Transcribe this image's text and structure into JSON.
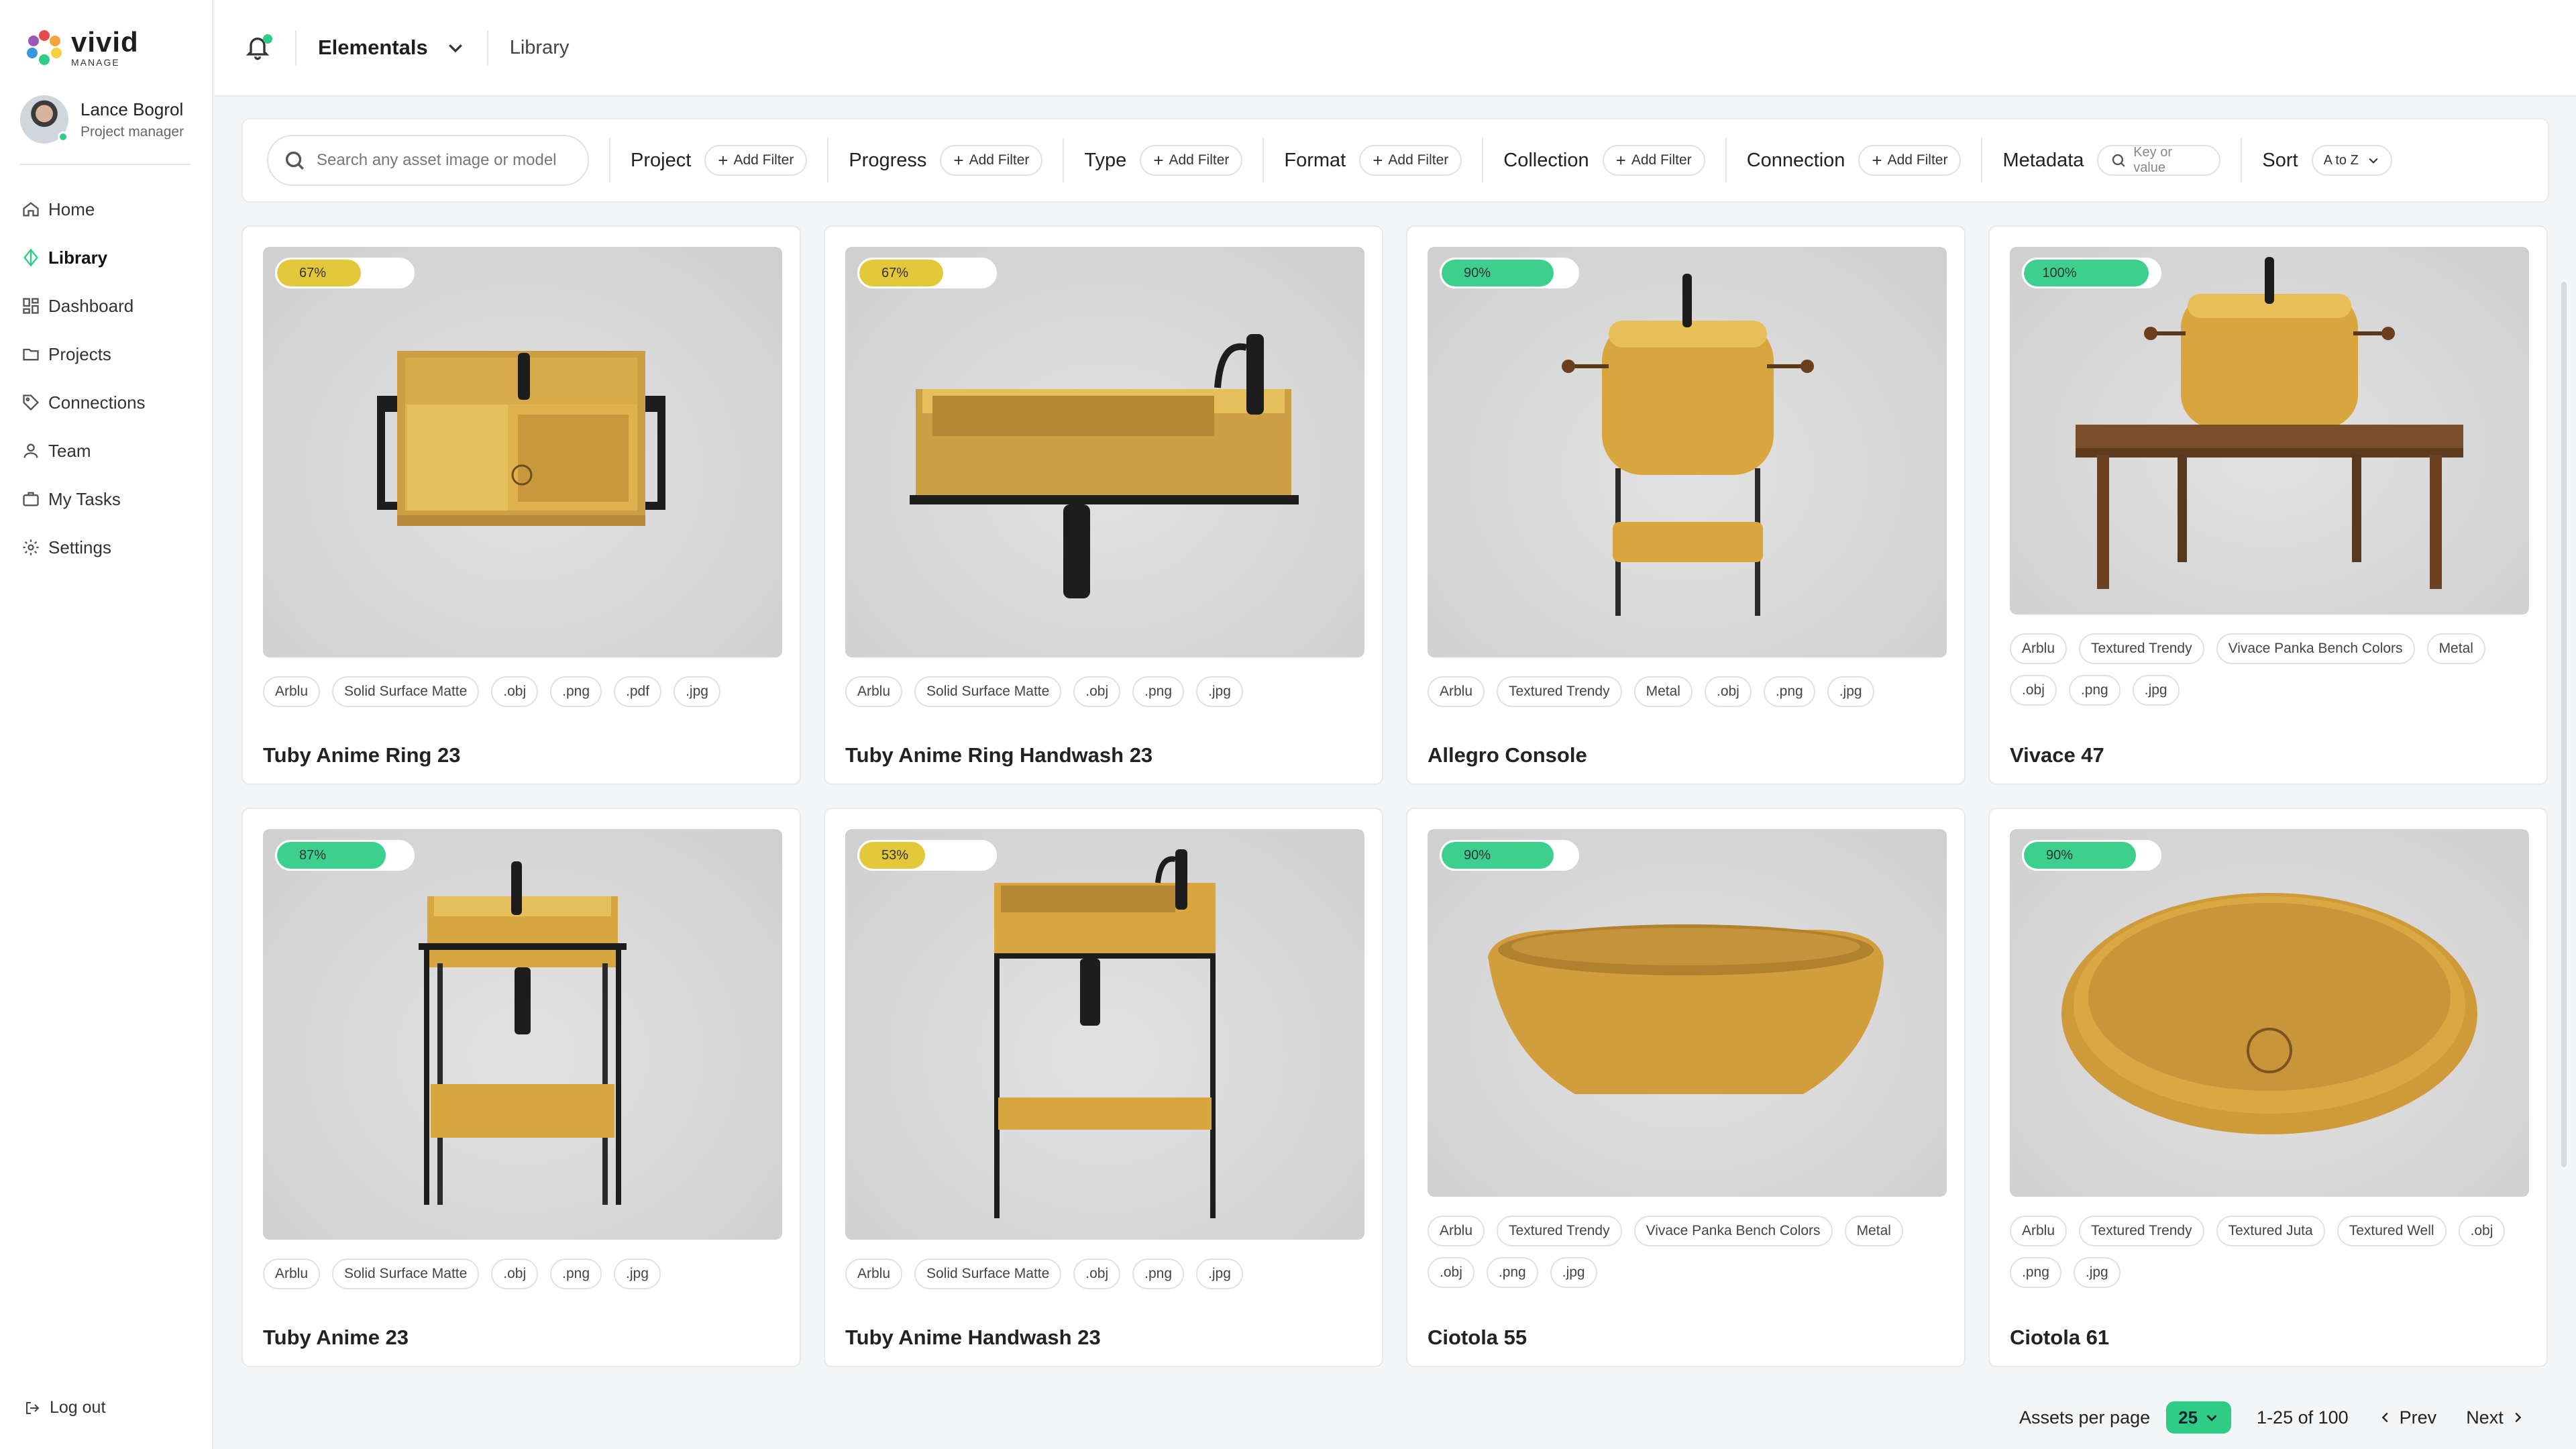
{
  "brand": {
    "name": "vivid",
    "sub": "MANAGE"
  },
  "user": {
    "name": "Lance Bogrol",
    "role": "Project manager"
  },
  "nav": [
    {
      "label": "Home",
      "icon": "home-icon"
    },
    {
      "label": "Library",
      "icon": "library-icon",
      "active": true
    },
    {
      "label": "Dashboard",
      "icon": "dashboard-icon"
    },
    {
      "label": "Projects",
      "icon": "folder-icon"
    },
    {
      "label": "Connections",
      "icon": "tag-icon"
    },
    {
      "label": "Team",
      "icon": "user-icon"
    },
    {
      "label": "My Tasks",
      "icon": "briefcase-icon"
    },
    {
      "label": "Settings",
      "icon": "gear-icon"
    }
  ],
  "logout": "Log out",
  "topbar": {
    "workspace": "Elementals",
    "breadcrumb": "Library"
  },
  "filters": {
    "search_placeholder": "Search any asset image or model",
    "groups": [
      "Project",
      "Progress",
      "Type",
      "Format",
      "Collection",
      "Connection"
    ],
    "add_filter": "Add Filter",
    "metadata_label": "Metadata",
    "metadata_placeholder": "Key or value",
    "sort_label": "Sort",
    "sort_value": "A to Z"
  },
  "colors": {
    "accent": "#2ecc86",
    "progress_yellow": "#e3c93a",
    "progress_green": "#3ccf8e",
    "sink": "#d8a53f"
  },
  "cards": [
    {
      "title": "Tuby Anime Ring 23",
      "progress": 67,
      "progress_label": "67%",
      "tags": [
        "Arblu",
        "Solid Surface Matte",
        ".obj",
        ".png",
        ".pdf",
        ".jpg"
      ]
    },
    {
      "title": "Tuby Anime Ring Handwash 23",
      "progress": 67,
      "progress_label": "67%",
      "tags": [
        "Arblu",
        "Solid Surface Matte",
        ".obj",
        ".png",
        ".jpg"
      ]
    },
    {
      "title": "Allegro Console",
      "progress": 90,
      "progress_label": "90%",
      "tags": [
        "Arblu",
        "Textured Trendy",
        "Metal",
        ".obj",
        ".png",
        ".jpg"
      ]
    },
    {
      "title": "Vivace 47",
      "progress": 100,
      "progress_label": "100%",
      "tags": [
        "Arblu",
        "Textured Trendy",
        "Vivace Panka Bench Colors",
        "Metal",
        ".obj",
        ".png",
        ".jpg"
      ]
    },
    {
      "title": "Tuby Anime 23",
      "progress": 87,
      "progress_label": "87%",
      "tags": [
        "Arblu",
        "Solid Surface Matte",
        ".obj",
        ".png",
        ".jpg"
      ]
    },
    {
      "title": "Tuby Anime Handwash 23",
      "progress": 53,
      "progress_label": "53%",
      "tags": [
        "Arblu",
        "Solid Surface Matte",
        ".obj",
        ".png",
        ".jpg"
      ]
    },
    {
      "title": "Ciotola 55",
      "progress": 90,
      "progress_label": "90%",
      "tags": [
        "Arblu",
        "Textured Trendy",
        "Vivace Panka Bench Colors",
        "Metal",
        ".obj",
        ".png",
        ".jpg"
      ]
    },
    {
      "title": "Ciotola 61",
      "progress": 90,
      "progress_label": "90%",
      "tags": [
        "Arblu",
        "Textured Trendy",
        "Textured Juta",
        "Textured Well",
        ".obj",
        ".png",
        ".jpg"
      ]
    }
  ],
  "pagination": {
    "per_page_label": "Assets per page",
    "per_page_value": "25",
    "range": "1-25 of 100",
    "prev": "Prev",
    "next": "Next"
  }
}
